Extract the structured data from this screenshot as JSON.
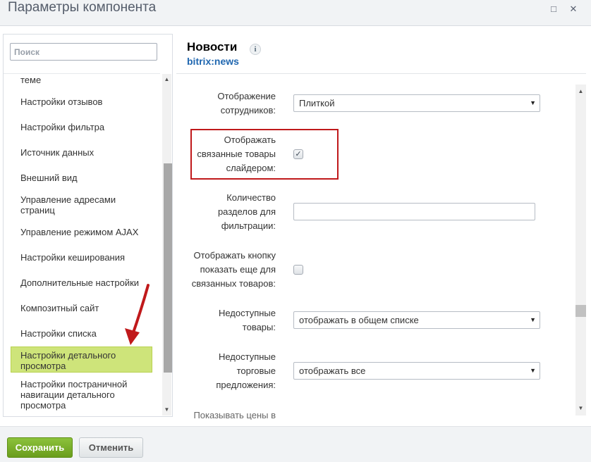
{
  "window": {
    "title": "Параметры компонента",
    "minimize_icon": "minimize-icon",
    "close_icon": "close-icon"
  },
  "sidebar": {
    "search_placeholder": "Поиск",
    "items": [
      {
        "label": "теме",
        "active": false
      },
      {
        "label": "Настройки отзывов",
        "active": false
      },
      {
        "label": "Настройки фильтра",
        "active": false
      },
      {
        "label": "Источник данных",
        "active": false
      },
      {
        "label": "Внешний вид",
        "active": false
      },
      {
        "label": "Управление адресами страниц",
        "active": false
      },
      {
        "label": "Управление режимом AJAX",
        "active": false
      },
      {
        "label": "Настройки кеширования",
        "active": false
      },
      {
        "label": "Дополнительные настройки",
        "active": false
      },
      {
        "label": "Композитный сайт",
        "active": false
      },
      {
        "label": "Настройки списка",
        "active": false
      },
      {
        "label": "Настройки детального просмотра",
        "active": true
      },
      {
        "label": "Настройки постраничной навигации детального просмотра",
        "active": false
      }
    ]
  },
  "header": {
    "name": "Новости",
    "code": "bitrix:news",
    "info_icon": "i"
  },
  "form": {
    "employees_display": {
      "label": "Отображение сотрудников:",
      "value": "Плиткой"
    },
    "related_slider": {
      "label": "Отображать связанные товары слайдером:",
      "checked": true
    },
    "sections_count": {
      "label": "Количество разделов для фильтрации:",
      "value": ""
    },
    "show_more_button": {
      "label": "Отображать кнопку показать еще для связанных товаров:",
      "checked": false
    },
    "unavailable_goods": {
      "label": "Недоступные товары:",
      "value": "отображать в общем списке"
    },
    "unavailable_offers": {
      "label": "Недоступные торговые предложения:",
      "value": "отображать все"
    },
    "cut_off_label": "Показывать цены в"
  },
  "footer": {
    "save_label": "Сохранить",
    "cancel_label": "Отменить"
  },
  "colors": {
    "active_item": "#cee47a",
    "highlight_border": "#c0191b",
    "link_blue": "#2067b0",
    "save_green": "#7ab32e"
  }
}
